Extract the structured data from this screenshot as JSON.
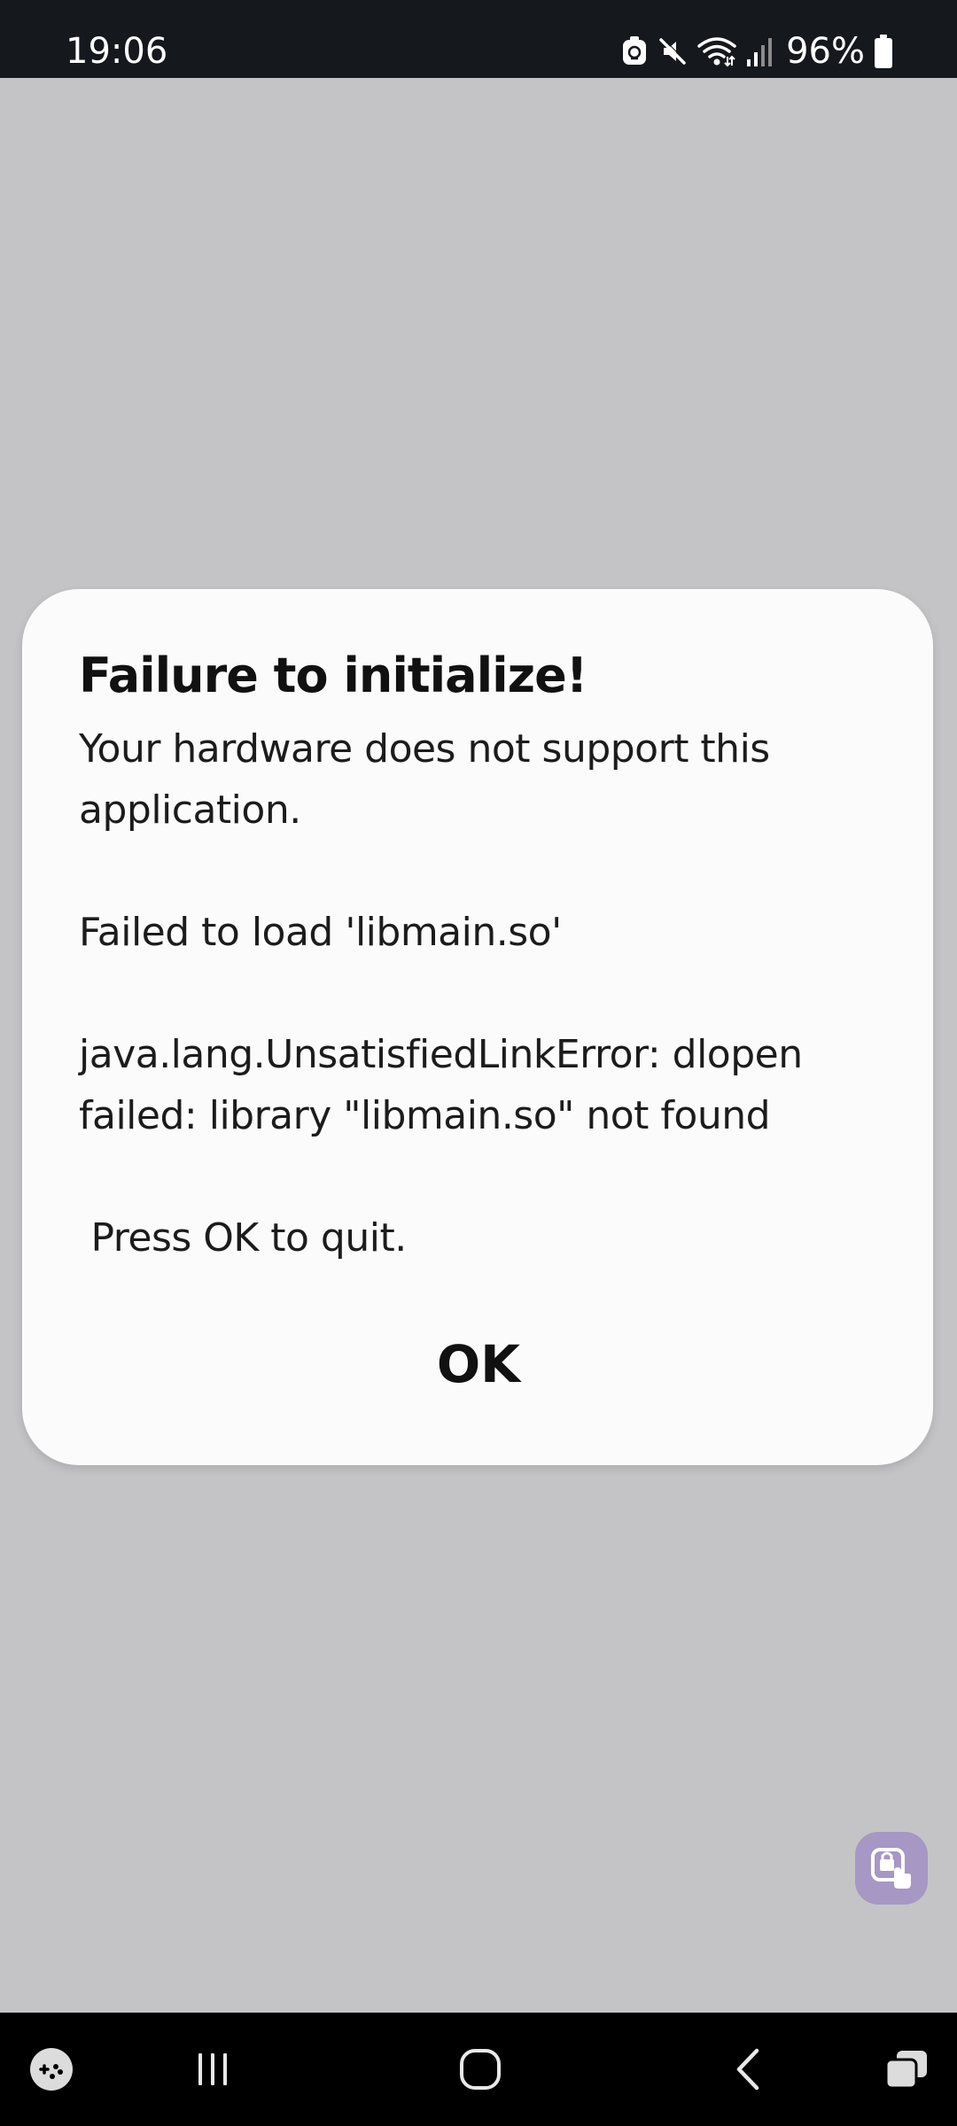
{
  "status_bar": {
    "time": "19:06",
    "battery": "96%",
    "icons": [
      "notification-app-icon",
      "mute-icon",
      "wifi-icon",
      "signal-icon",
      "battery-icon"
    ]
  },
  "dialog": {
    "title": "Failure to initialize!",
    "message": "Your hardware does not support this application.\n\nFailed to load 'libmain.so'\n\njava.lang.UnsatisfiedLinkError: dlopen failed: library \"libmain.so\" not found\n\n Press OK to quit.",
    "ok_label": "OK"
  },
  "floating_button": {
    "icon": "touch-lock-icon",
    "color": "#a797c4"
  },
  "nav_bar": {
    "items": [
      "game-launcher-icon",
      "recents-icon",
      "home-icon",
      "back-icon",
      "multiwindow-icon"
    ]
  },
  "colors": {
    "background": "#c4c4c6",
    "status_bar": "#15181c",
    "dialog": "#fbfbfb",
    "nav_bar": "#000000"
  }
}
